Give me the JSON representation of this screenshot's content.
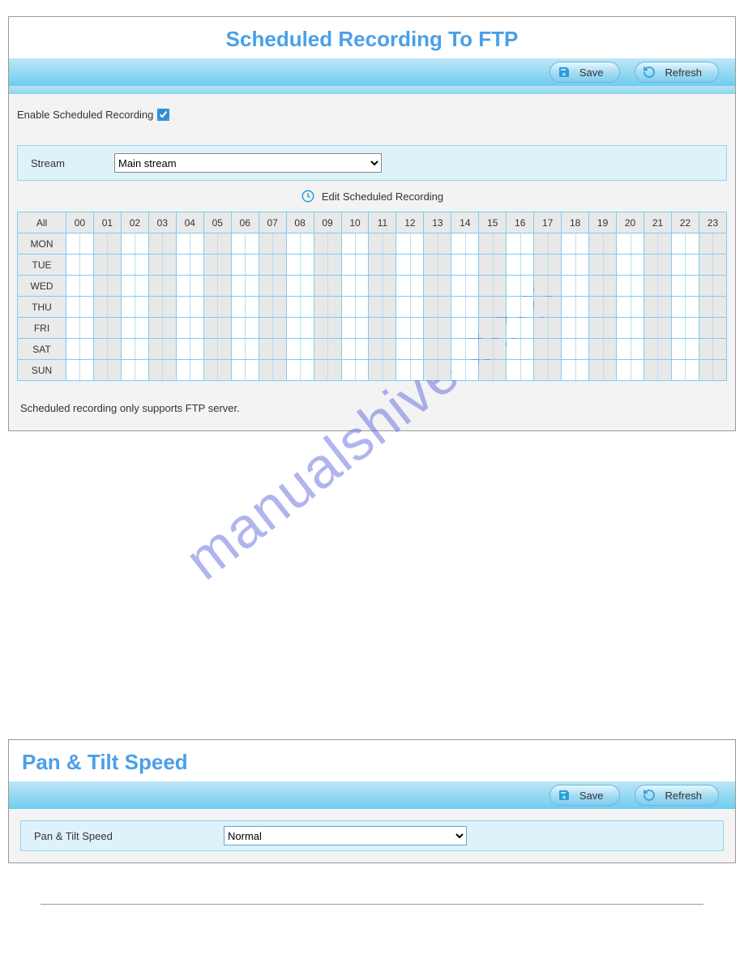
{
  "watermark": "manualshive.com",
  "panel1": {
    "title": "Scheduled Recording To FTP",
    "toolbar": {
      "save_label": "Save",
      "refresh_label": "Refresh"
    },
    "enable_label": "Enable Scheduled Recording",
    "enable_checked": true,
    "stream_label": "Stream",
    "stream_value": "Main stream",
    "edit_label": "Edit Scheduled Recording",
    "schedule": {
      "all_label": "All",
      "hours": [
        "00",
        "01",
        "02",
        "03",
        "04",
        "05",
        "06",
        "07",
        "08",
        "09",
        "10",
        "11",
        "12",
        "13",
        "14",
        "15",
        "16",
        "17",
        "18",
        "19",
        "20",
        "21",
        "22",
        "23"
      ],
      "days": [
        "MON",
        "TUE",
        "WED",
        "THU",
        "FRI",
        "SAT",
        "SUN"
      ]
    },
    "footnote": "Scheduled recording only supports FTP server."
  },
  "panel2": {
    "title": "Pan & Tilt Speed",
    "toolbar": {
      "save_label": "Save",
      "refresh_label": "Refresh"
    },
    "speed_label": "Pan & Tilt Speed",
    "speed_value": "Normal"
  }
}
